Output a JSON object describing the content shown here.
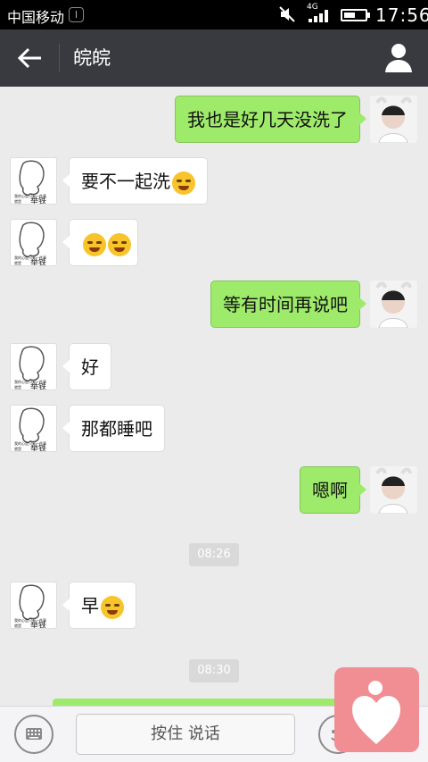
{
  "status": {
    "carrier": "中国移动",
    "carrier_icon": "I",
    "network": "4G",
    "time": "17:56"
  },
  "header": {
    "title": "皖皖"
  },
  "messages": [
    {
      "side": "me",
      "text": "我也是好几天没洗了"
    },
    {
      "side": "other",
      "text": "要不一起洗",
      "emoji": "grinning-face"
    },
    {
      "side": "other",
      "text": "",
      "emoji": "crying-laughing-faces"
    },
    {
      "side": "me",
      "text": "等有时间再说吧"
    },
    {
      "side": "other",
      "text": "好"
    },
    {
      "side": "other",
      "text": "那都睡吧"
    },
    {
      "side": "me",
      "text": "嗯啊"
    },
    {
      "side": "time",
      "text": "08:26"
    },
    {
      "side": "other",
      "text": "早",
      "emoji": "hugging-face"
    },
    {
      "side": "time",
      "text": "08:30"
    }
  ],
  "avatar_caption": {
    "line1": "我的心是只有一件事",
    "line2": "就是",
    "line3": "举铁"
  },
  "input": {
    "voice_label": "按住 说话"
  }
}
